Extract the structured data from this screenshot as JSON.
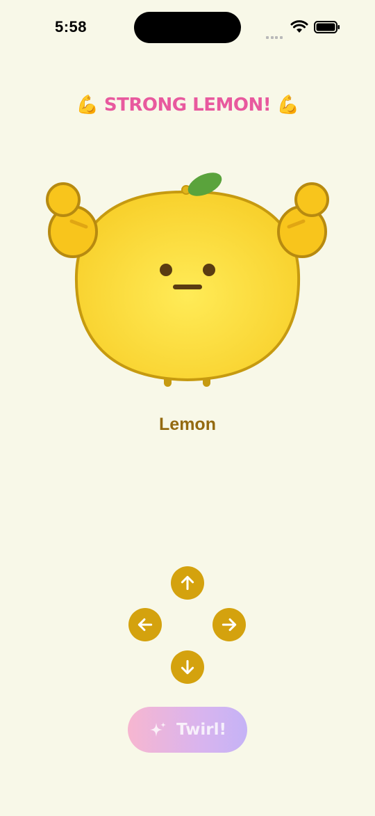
{
  "status_bar": {
    "time": "5:58"
  },
  "banner": {
    "text": "💪 STRONG LEMON! 💪"
  },
  "character": {
    "name": "Lemon"
  },
  "controls": {
    "up_icon": "arrow-up-icon",
    "left_icon": "arrow-left-icon",
    "right_icon": "arrow-right-icon",
    "down_icon": "arrow-down-icon"
  },
  "twirl": {
    "label": "Twirl!",
    "icon": "sparkles-icon"
  },
  "colors": {
    "background": "#f8f8e8",
    "banner": "#e8599e",
    "name": "#946a10",
    "dpad": "#d4a20e",
    "lemon": "#fde13a",
    "lemon_outline": "#c69a10",
    "leaf": "#5aa33c"
  }
}
